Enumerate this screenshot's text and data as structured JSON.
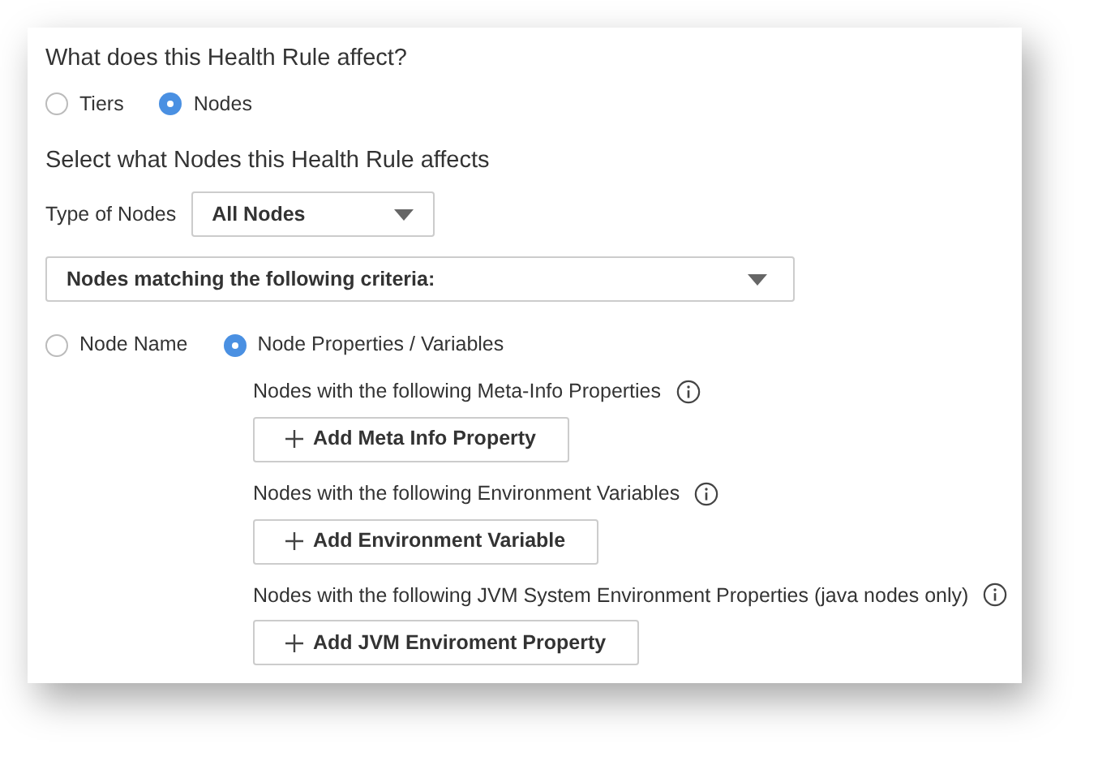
{
  "heading": "What does this Health Rule affect?",
  "affect_options": [
    {
      "label": "Tiers",
      "selected": false
    },
    {
      "label": "Nodes",
      "selected": true
    }
  ],
  "subheading": "Select what Nodes this Health Rule affects",
  "type_of_nodes": {
    "label": "Type of Nodes",
    "value": "All Nodes"
  },
  "criteria_dropdown": {
    "value": "Nodes matching the following criteria:"
  },
  "match_options": [
    {
      "label": "Node Name",
      "selected": false
    },
    {
      "label": "Node Properties / Variables",
      "selected": true
    }
  ],
  "sections": [
    {
      "label": "Nodes with the following Meta-Info Properties",
      "button": "Add Meta Info Property"
    },
    {
      "label": "Nodes with the following Environment Variables",
      "button": "Add Environment Variable"
    },
    {
      "label": "Nodes with the following JVM System Environment Properties (java nodes only)",
      "button": "Add JVM Enviroment Property"
    }
  ]
}
